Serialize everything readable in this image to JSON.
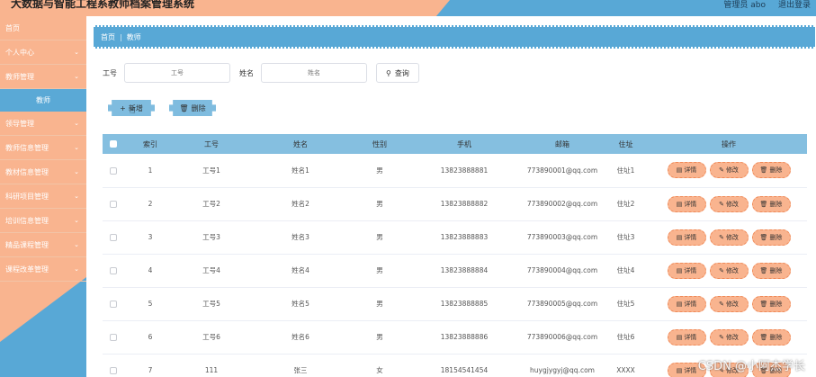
{
  "header": {
    "title": "大数据与智能工程系教师档案管理系统",
    "user": "管理员 abo",
    "logout": "退出登录"
  },
  "sidebar": {
    "items": [
      {
        "label": "首页",
        "chevron": false
      },
      {
        "label": "个人中心",
        "chevron": true
      },
      {
        "label": "教师管理",
        "chevron": true,
        "sub": "教师"
      },
      {
        "label": "领导管理",
        "chevron": true
      },
      {
        "label": "教师信息管理",
        "chevron": true
      },
      {
        "label": "教材信息管理",
        "chevron": true
      },
      {
        "label": "科研项目管理",
        "chevron": true
      },
      {
        "label": "培训信息管理",
        "chevron": true
      },
      {
        "label": "精品课程管理",
        "chevron": true
      },
      {
        "label": "课程改革管理",
        "chevron": true
      }
    ]
  },
  "breadcrumb": {
    "home": "首页",
    "current": "教师"
  },
  "search": {
    "id_label": "工号",
    "id_placeholder": "工号",
    "name_label": "姓名",
    "name_placeholder": "姓名",
    "query_label": "查询"
  },
  "actions": {
    "add_label": "新增",
    "delete_label": "删除"
  },
  "table": {
    "headers": [
      "索引",
      "工号",
      "姓名",
      "性别",
      "手机",
      "邮箱",
      "住址",
      "操作"
    ],
    "rows": [
      {
        "index": "1",
        "id": "工号1",
        "name": "姓名1",
        "gender": "男",
        "phone": "13823888881",
        "email": "773890001@qq.com",
        "address": "住址1"
      },
      {
        "index": "2",
        "id": "工号2",
        "name": "姓名2",
        "gender": "男",
        "phone": "13823888882",
        "email": "773890002@qq.com",
        "address": "住址2"
      },
      {
        "index": "3",
        "id": "工号3",
        "name": "姓名3",
        "gender": "男",
        "phone": "13823888883",
        "email": "773890003@qq.com",
        "address": "住址3"
      },
      {
        "index": "4",
        "id": "工号4",
        "name": "姓名4",
        "gender": "男",
        "phone": "13823888884",
        "email": "773890004@qq.com",
        "address": "住址4"
      },
      {
        "index": "5",
        "id": "工号5",
        "name": "姓名5",
        "gender": "男",
        "phone": "13823888885",
        "email": "773890005@qq.com",
        "address": "住址5"
      },
      {
        "index": "6",
        "id": "工号6",
        "name": "姓名6",
        "gender": "男",
        "phone": "13823888886",
        "email": "773890006@qq.com",
        "address": "住址6"
      },
      {
        "index": "7",
        "id": "111",
        "name": "张三",
        "gender": "女",
        "phone": "18154541454",
        "email": "huygjygyj@qq.com",
        "address": "XXXX"
      }
    ],
    "ops": {
      "detail": "详情",
      "edit": "修改",
      "delete": "删除"
    }
  },
  "watermark": "CSDN @小阿杰学长",
  "colors": {
    "peach": "#f9b48f",
    "blue": "#58a8d6",
    "header_blue": "#85bfe0"
  }
}
